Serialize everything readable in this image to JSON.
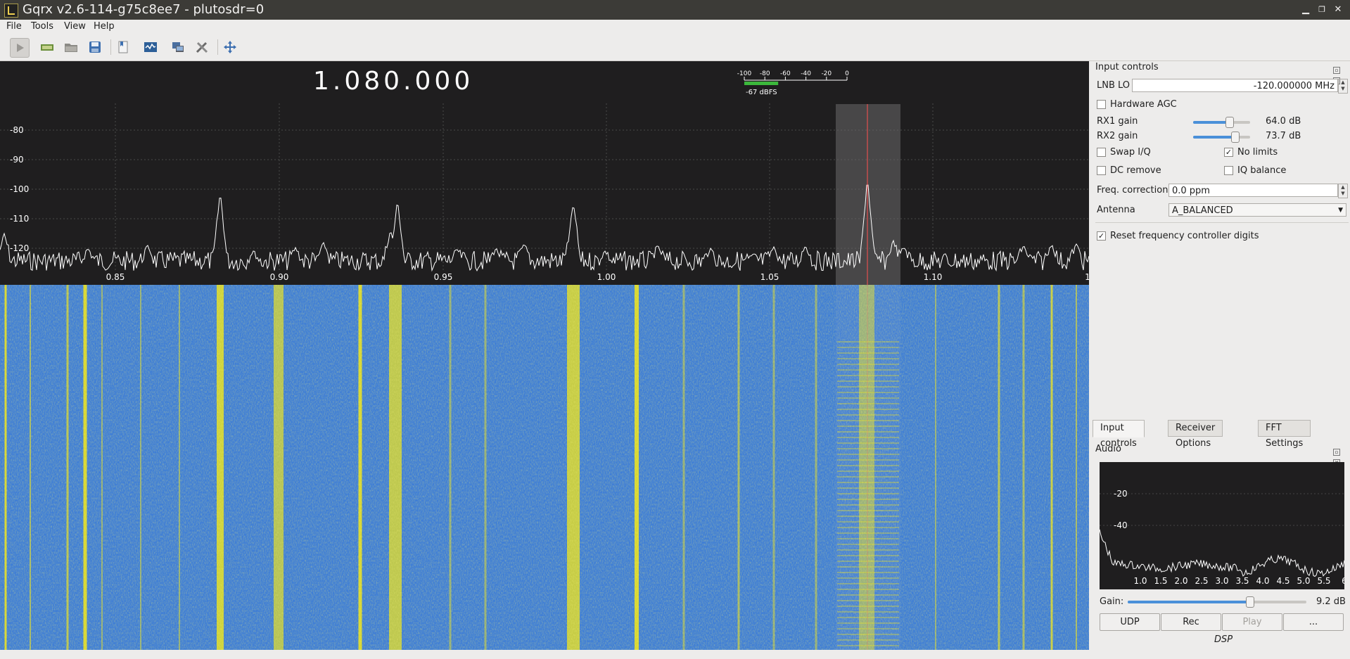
{
  "window": {
    "title": "Gqrx v2.6-114-g75c8ee7 - plutosdr=0"
  },
  "menu": {
    "items": [
      "File",
      "Tools",
      "View",
      "Help"
    ]
  },
  "toolbar": {
    "buttons": [
      "start-dsp",
      "io-devices",
      "load-settings",
      "save-settings",
      "bookmarks",
      "rds",
      "remote-control",
      "settings",
      "fullscreen"
    ]
  },
  "spectrum": {
    "frequency_display": "1.080.000",
    "smeter": {
      "scale": [
        "-100",
        "-80",
        "-60",
        "-40",
        "-20",
        "0"
      ],
      "reading": "-67 dBFS",
      "fill_fraction": 0.33
    },
    "y_ticks": [
      "-80",
      "-90",
      "-100",
      "-110",
      "-120"
    ],
    "x_ticks": [
      "0.85",
      "0.90",
      "0.95",
      "1.00",
      "1.05",
      "1.10",
      "1"
    ],
    "colors": {
      "background": "#1f1e1f",
      "trace": "#ffffff",
      "filter": "#6a6a6a",
      "center": "#ff4040"
    }
  },
  "waterfall": {
    "colors": {
      "base": "#3f7ed6",
      "signal": "#e8e020"
    }
  },
  "input_controls": {
    "title": "Input controls",
    "lnb_lo_label": "LNB LO",
    "lnb_lo_value": "-120.000000 MHz",
    "hardware_agc": "Hardware AGC",
    "rx1_label": "RX1 gain",
    "rx1_value": "64.0 dB",
    "rx1_fraction": 0.63,
    "rx2_label": "RX2 gain",
    "rx2_value": "73.7 dB",
    "rx2_fraction": 0.73,
    "swap_iq": "Swap I/Q",
    "no_limits": "No limits",
    "dc_remove": "DC remove",
    "iq_balance": "IQ balance",
    "freq_corr_label": "Freq. correction",
    "freq_corr_value": "0.0 ppm",
    "antenna_label": "Antenna",
    "antenna_value": "A_BALANCED",
    "reset_digits": "Reset frequency controller digits"
  },
  "tabs": [
    "Input controls",
    "Receiver Options",
    "FFT Settings"
  ],
  "audio": {
    "title": "Audio",
    "y_ticks": [
      "-20",
      "-40"
    ],
    "x_ticks": [
      "1.0",
      "1.5",
      "2.0",
      "2.5",
      "3.0",
      "3.5",
      "4.0",
      "4.5",
      "5.0",
      "5.5",
      "6"
    ],
    "gain_label": "Gain:",
    "gain_value": "9.2 dB",
    "gain_fraction": 0.68,
    "buttons": {
      "udp": "UDP",
      "rec": "Rec",
      "play": "Play",
      "more": "..."
    },
    "dsp_label": "DSP"
  }
}
